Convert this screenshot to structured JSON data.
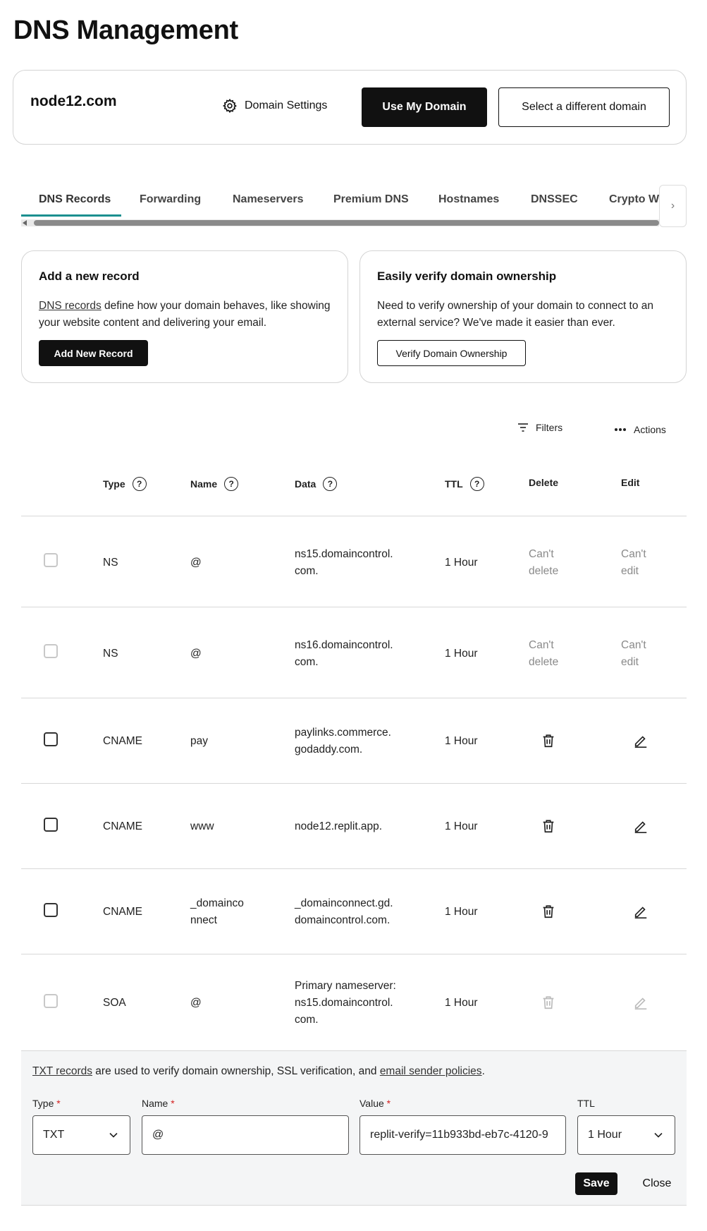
{
  "page": {
    "title": "DNS Management"
  },
  "domain_card": {
    "domain": "node12.com",
    "settings_label": "Domain Settings",
    "use_my_domain_label": "Use My Domain",
    "select_domain_label": "Select a different domain"
  },
  "tabs": [
    {
      "label": "DNS Records",
      "active": true
    },
    {
      "label": "Forwarding"
    },
    {
      "label": "Nameservers"
    },
    {
      "label": "Premium DNS"
    },
    {
      "label": "Hostnames"
    },
    {
      "label": "DNSSEC"
    },
    {
      "label": "Crypto W"
    }
  ],
  "add_record_card": {
    "title": "Add a new record",
    "link_text": "DNS records",
    "text": " define how your domain behaves, like showing your website content and delivering your email.",
    "button": "Add New Record"
  },
  "verify_card": {
    "title": "Easily verify domain ownership",
    "text": "Need to verify ownership of your domain to connect to an external service? We've made it easier than ever.",
    "button": "Verify Domain Ownership"
  },
  "toolbar": {
    "filters": "Filters",
    "actions": "Actions"
  },
  "table": {
    "headers": {
      "type": "Type",
      "name": "Name",
      "data": "Data",
      "ttl": "TTL",
      "delete": "Delete",
      "edit": "Edit"
    },
    "rows": [
      {
        "type": "NS",
        "name": "@",
        "data": "ns15.domaincontrol.\ncom.",
        "ttl": "1 Hour",
        "delete": "Can't\ndelete",
        "edit": "Can't\nedit"
      },
      {
        "type": "NS",
        "name": "@",
        "data": "ns16.domaincontrol.\ncom.",
        "ttl": "1 Hour",
        "delete": "Can't\ndelete",
        "edit": "Can't\nedit"
      },
      {
        "type": "CNAME",
        "name": "pay",
        "data": "paylinks.commerce.\ngodaddy.com.",
        "ttl": "1 Hour"
      },
      {
        "type": "CNAME",
        "name": "www",
        "data": "node12.replit.app.",
        "ttl": "1 Hour"
      },
      {
        "type": "CNAME",
        "name": "_domainco\nnnect",
        "data": "_domainconnect.gd.\ndomaincontrol.com.",
        "ttl": "1 Hour"
      },
      {
        "type": "SOA",
        "name": "@",
        "data": "Primary nameserver:\nns15.domaincontrol.\ncom.",
        "ttl": "1 Hour"
      }
    ]
  },
  "txt_form": {
    "note_link1": "TXT records",
    "note_mid": " are used to verify domain ownership, SSL verification, and ",
    "note_link2": "email sender policies",
    "note_end": ".",
    "type_label": "Type",
    "name_label": "Name",
    "value_label": "Value",
    "ttl_label": "TTL",
    "type_value": "TXT",
    "name_value": "@",
    "value_value": "replit-verify=11b933bd-eb7c-4120-9",
    "ttl_value": "1 Hour",
    "save": "Save",
    "close": "Close"
  }
}
